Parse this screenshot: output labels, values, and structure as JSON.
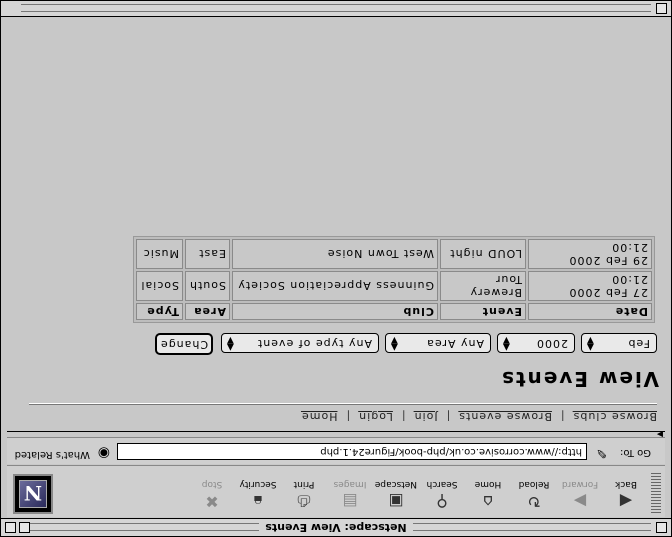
{
  "window": {
    "title": "Netscape: View Events"
  },
  "toolbar": {
    "buttons": [
      {
        "label": "Back",
        "icon": "back-arrow-icon",
        "enabled": true
      },
      {
        "label": "Forward",
        "icon": "forward-arrow-icon",
        "enabled": false
      },
      {
        "label": "Reload",
        "icon": "reload-icon",
        "enabled": true
      },
      {
        "label": "Home",
        "icon": "home-icon",
        "enabled": true
      },
      {
        "label": "Search",
        "icon": "search-icon",
        "enabled": true
      },
      {
        "label": "Netscape",
        "icon": "netscape-icon",
        "enabled": true
      },
      {
        "label": "Images",
        "icon": "images-icon",
        "enabled": false
      },
      {
        "label": "Print",
        "icon": "print-icon",
        "enabled": true
      },
      {
        "label": "Security",
        "icon": "lock-icon",
        "enabled": true
      },
      {
        "label": "Stop",
        "icon": "stop-icon",
        "enabled": false
      }
    ],
    "logo_letter": "N"
  },
  "location": {
    "label": "Go To:",
    "url": "http://www.corrosive.co.uk/php-book/Figure24.1.php",
    "related_label": "What's Related"
  },
  "page": {
    "nav": [
      "Browse clubs",
      "Browse events",
      "Join",
      "Login",
      "Home"
    ],
    "title": "View Events",
    "filters": {
      "month": "Feb",
      "year": "2000",
      "area": "Any Area",
      "event_type": "Any type of event",
      "submit_label": "Change"
    },
    "table": {
      "headers": [
        "Date",
        "Event",
        "Club",
        "Area",
        "Type"
      ],
      "rows": [
        [
          "27 Feb 2000 21:00",
          "Brewery Tour",
          "Guinness Appreciation Society",
          "South",
          "Social"
        ],
        [
          "29 Feb 2000 21:00",
          "LOUD night",
          "West Town Noise",
          "East",
          "Music"
        ]
      ]
    }
  },
  "colors": {
    "background": "#c8c8c8",
    "frame": "#000000"
  }
}
